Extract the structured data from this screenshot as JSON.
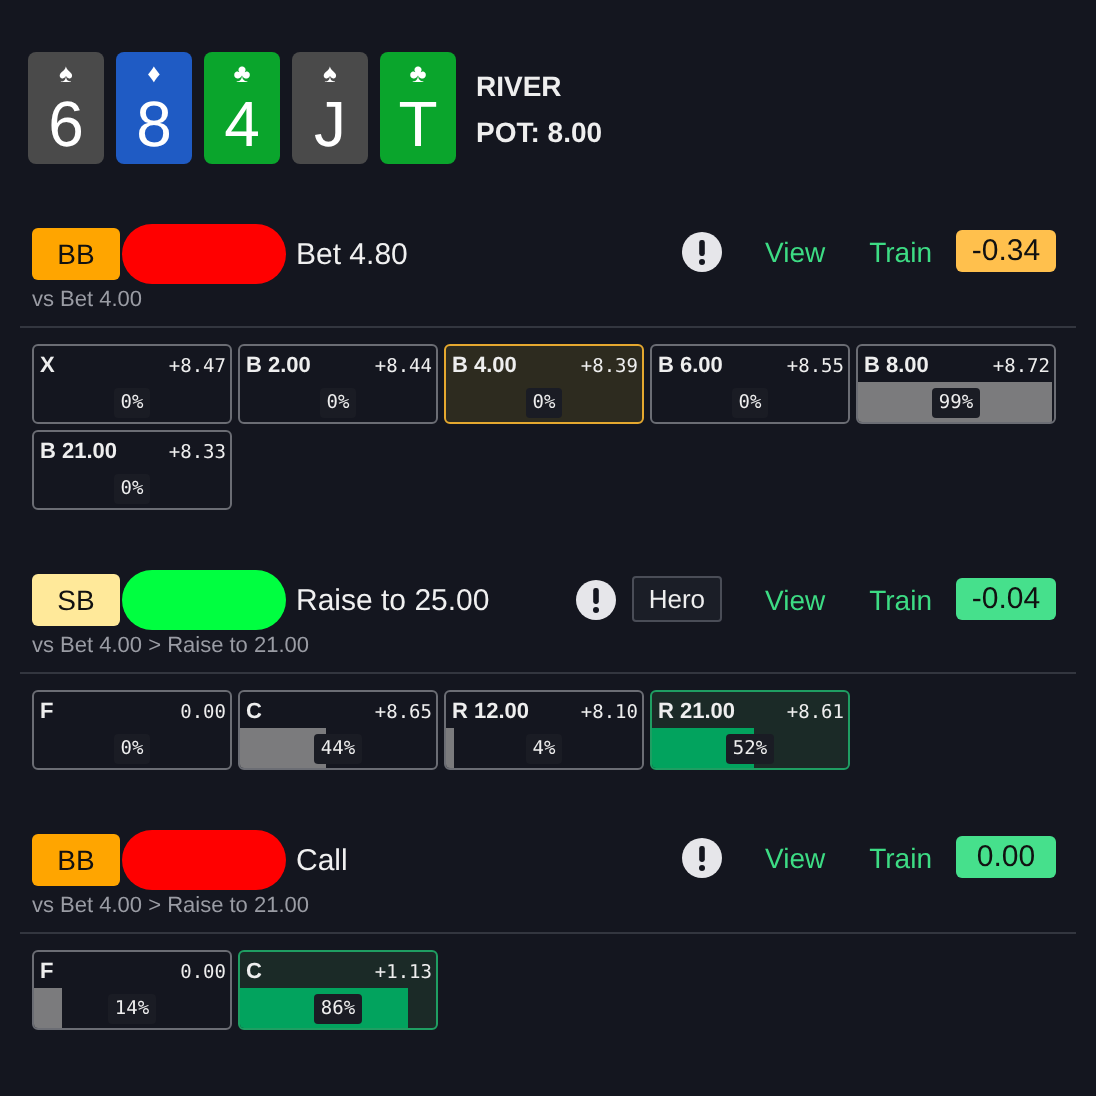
{
  "board": {
    "cards": [
      {
        "suit": "♠",
        "rank": "6",
        "color": "#4a4a4a"
      },
      {
        "suit": "♦",
        "rank": "8",
        "color": "#1f5bc4"
      },
      {
        "suit": "♣",
        "rank": "4",
        "color": "#0aa52c"
      },
      {
        "suit": "♠",
        "rank": "J",
        "color": "#4a4a4a"
      },
      {
        "suit": "♣",
        "rank": "T",
        "color": "#0aa52c"
      }
    ],
    "street": "RIVER",
    "pot": "POT: 8.00"
  },
  "sections": [
    {
      "position": {
        "label": "BB",
        "color": "#ffa500"
      },
      "redaction": {
        "color": "#ff0000"
      },
      "action": "Bet 4.80",
      "path": "vs Bet 4.00",
      "view": "View",
      "train": "Train",
      "score": {
        "value": "-0.34",
        "color": "#ffc04d"
      },
      "cells": [
        {
          "label": "X",
          "ev": "+8.47",
          "percent": "0%",
          "kind": "plain"
        },
        {
          "label": "B 2.00",
          "ev": "+8.44",
          "percent": "0%",
          "kind": "plain"
        },
        {
          "label": "B 4.00",
          "ev": "+8.39",
          "percent": "0%",
          "kind": "selected"
        },
        {
          "label": "B 6.00",
          "ev": "+8.55",
          "percent": "0%",
          "kind": "plain"
        },
        {
          "label": "B 8.00",
          "ev": "+8.72",
          "percent": "99%",
          "level": 0.99,
          "kind": "plain"
        },
        {
          "label": "B 21.00",
          "ev": "+8.33",
          "percent": "0%",
          "kind": "plain"
        }
      ]
    },
    {
      "position": {
        "label": "SB",
        "color": "#ffe99a"
      },
      "redaction": {
        "color": "#00ff40"
      },
      "action": "Raise to 25.00",
      "path": "vs Bet 4.00 > Raise to 21.00",
      "tag": "Hero",
      "view": "View",
      "train": "Train",
      "score": {
        "value": "-0.04",
        "color": "#46e08c"
      },
      "cells": [
        {
          "label": "F",
          "ev": "0.00",
          "percent": "0%",
          "kind": "plain"
        },
        {
          "label": "C",
          "ev": "+8.65",
          "percent": "44%",
          "level": 0.44,
          "kind": "plain"
        },
        {
          "label": "R 12.00",
          "ev": "+8.10",
          "percent": "4%",
          "level": 0.04,
          "kind": "plain"
        },
        {
          "label": "R 21.00",
          "ev": "+8.61",
          "percent": "52%",
          "level": 0.52,
          "kind": "chosen"
        }
      ]
    },
    {
      "position": {
        "label": "BB",
        "color": "#ffa500"
      },
      "redaction": {
        "color": "#ff0000"
      },
      "action": "Call",
      "path": "vs Bet 4.00 > Raise to 21.00",
      "view": "View",
      "train": "Train",
      "score": {
        "value": "0.00",
        "color": "#46e08c"
      },
      "cells": [
        {
          "label": "F",
          "ev": "0.00",
          "percent": "14%",
          "level": 0.14,
          "kind": "plain"
        },
        {
          "label": "C",
          "ev": "+1.13",
          "percent": "86%",
          "level": 0.86,
          "kind": "chosen"
        }
      ]
    }
  ]
}
